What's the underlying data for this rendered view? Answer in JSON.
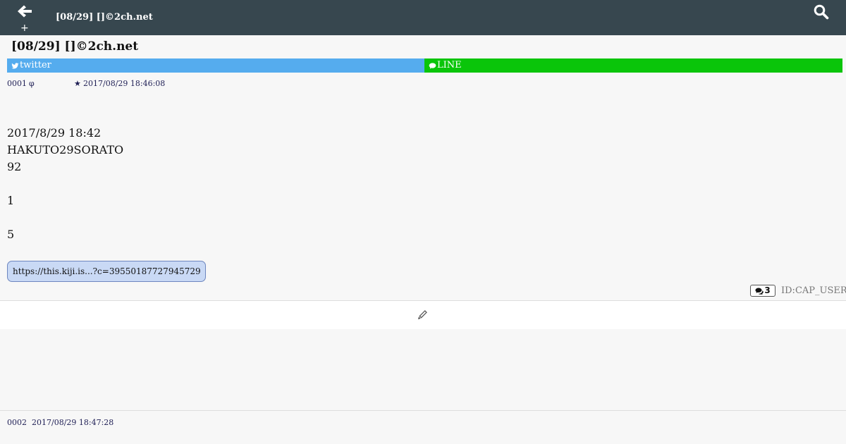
{
  "header": {
    "plus_label": "+",
    "title": "[08/29] []©2ch.net",
    "icons": {
      "back": "arrow-left-icon",
      "search": "search-icon"
    },
    "bar_color": "#37474f"
  },
  "thread": {
    "title": "[08/29] []©2ch.net"
  },
  "share": {
    "twitter_label": "twitter",
    "twitter_color": "#55acee",
    "line_label": "LINE",
    "line_color": "#0ac50a"
  },
  "posts": [
    {
      "number": "0001",
      "name": "φ",
      "star": "★",
      "timestamp": "2017/08/29 18:46:08",
      "body": [
        "",
        "",
        "2017/8/29 18:42",
        "HAKUTO29SORATO",
        "92",
        "",
        "1",
        "",
        "5"
      ],
      "link": "https://this.kiji.is...?c=39550187727945729",
      "reply_count": "3",
      "id": "ID:CAP_USER"
    },
    {
      "number": "0002",
      "timestamp": "2017/08/29 18:47:28"
    }
  ],
  "write": {
    "icon": "pencil-icon"
  }
}
